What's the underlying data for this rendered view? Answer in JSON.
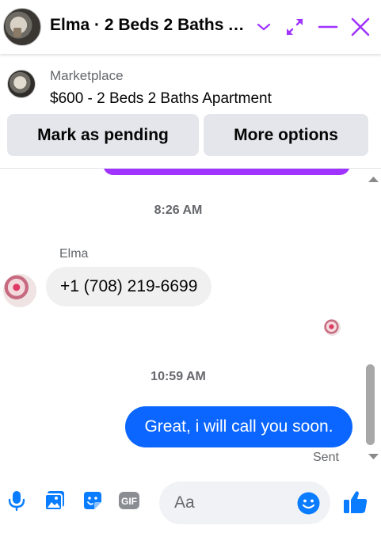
{
  "header": {
    "title": "Elma · 2 Beds 2 Baths Apartment",
    "avatar_icon": "listing-photo",
    "icons": [
      "chevron-down-icon",
      "expand-icon",
      "minimize-icon",
      "close-icon"
    ],
    "accent_color": "#a033ff"
  },
  "listing": {
    "source": "Marketplace",
    "title": "$600 - 2 Beds 2 Baths Apartment",
    "buttons": {
      "pending": "Mark as pending",
      "more": "More options"
    }
  },
  "thread": {
    "timestamp_1": "8:26 AM",
    "sender_name": "Elma",
    "incoming_message": "+1 (708) 219-6699",
    "timestamp_2": "10:59 AM",
    "outgoing_message": "Great, i will call you soon.",
    "status": "Sent",
    "outgoing_color": "#0a66ff"
  },
  "composer": {
    "placeholder": "Aa",
    "icons": [
      "microphone-icon",
      "photo-icon",
      "sticker-icon",
      "gif-icon",
      "emoji-icon",
      "like-icon"
    ],
    "gif_label": "GIF",
    "icon_color": "#0a7cff"
  }
}
